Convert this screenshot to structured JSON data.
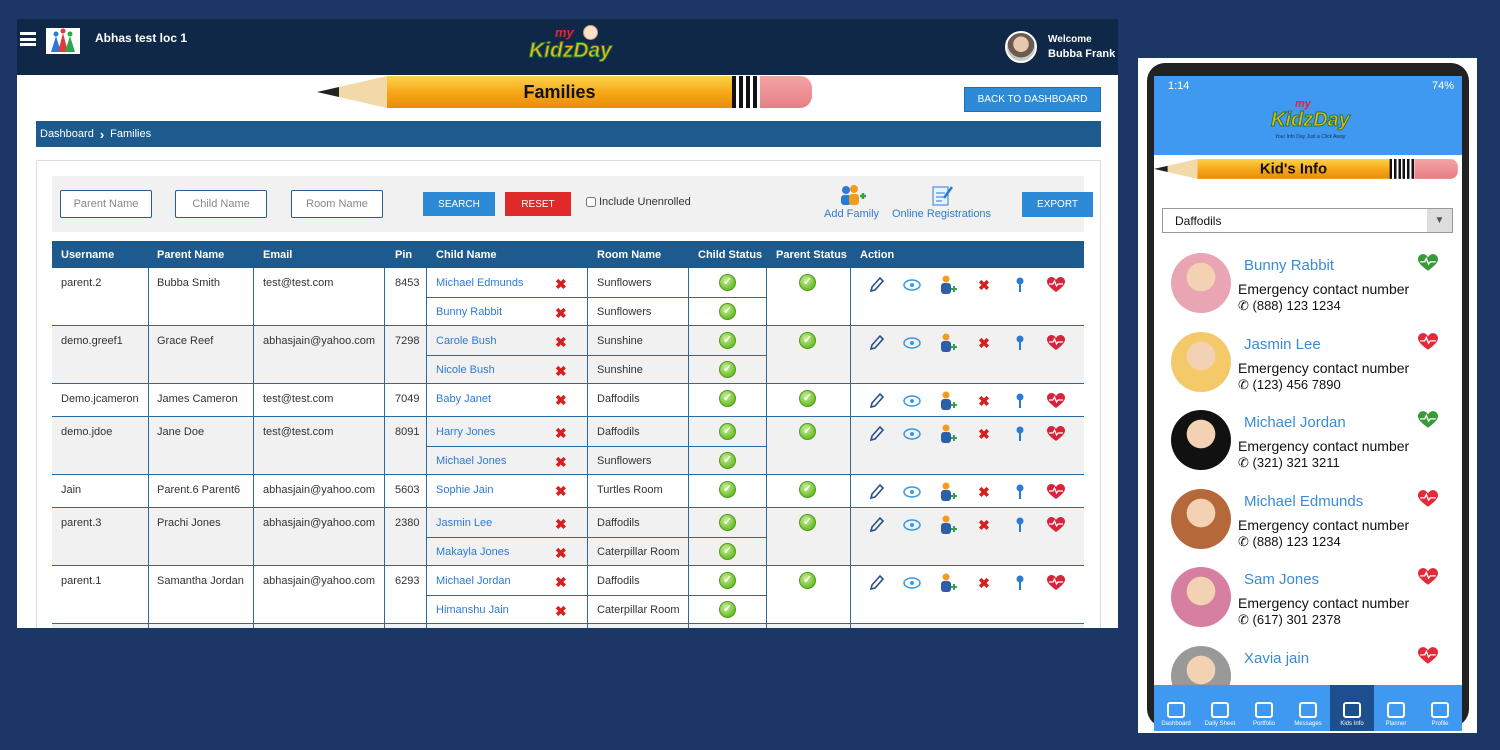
{
  "desktop": {
    "location_name": "Abhas test loc 1",
    "brand_my": "my",
    "brand_name": "KidzDay",
    "welcome": "Welcome",
    "user_name": "Bubba Frank",
    "page_banner": "Families",
    "back_button": "BACK TO DASHBOARD",
    "breadcrumb": [
      "Dashboard",
      "Families"
    ],
    "filters": {
      "parent_placeholder": "Parent Name",
      "child_placeholder": "Child Name",
      "room_placeholder": "Room Name",
      "search_label": "SEARCH",
      "reset_label": "RESET",
      "unenrolled_label": "Include Unenrolled",
      "add_family_label": "Add Family",
      "online_reg_label": "Online Registrations",
      "export_label": "EXPORT"
    },
    "columns": [
      "Username",
      "Parent Name",
      "Email",
      "Pin",
      "Child Name",
      "Room Name",
      "Child Status",
      "Parent Status",
      "Action"
    ],
    "families": [
      {
        "username": "parent.2",
        "parent": "Bubba Smith",
        "email": "test@test.com",
        "pin": "8453",
        "children": [
          {
            "name": "Michael Edmunds",
            "room": "Sunflowers"
          },
          {
            "name": "Bunny Rabbit",
            "room": "Sunflowers"
          }
        ]
      },
      {
        "username": "demo.greef1",
        "parent": "Grace Reef",
        "email": "abhasjain@yahoo.com",
        "pin": "7298",
        "children": [
          {
            "name": "Carole Bush",
            "room": "Sunshine"
          },
          {
            "name": "Nicole Bush",
            "room": "Sunshine"
          }
        ]
      },
      {
        "username": "Demo.jcameron",
        "parent": "James Cameron",
        "email": "test@test.com",
        "pin": "7049",
        "children": [
          {
            "name": "Baby Janet",
            "room": "Daffodils"
          }
        ]
      },
      {
        "username": "demo.jdoe",
        "parent": "Jane Doe",
        "email": "test@test.com",
        "pin": "8091",
        "children": [
          {
            "name": "Harry Jones",
            "room": "Daffodils"
          },
          {
            "name": "Michael Jones",
            "room": "Sunflowers"
          }
        ]
      },
      {
        "username": "Jain",
        "parent": "Parent.6 Parent6",
        "email": "abhasjain@yahoo.com",
        "pin": "5603",
        "children": [
          {
            "name": "Sophie Jain",
            "room": "Turtles Room"
          }
        ]
      },
      {
        "username": "parent.3",
        "parent": "Prachi Jones",
        "email": "abhasjain@yahoo.com",
        "pin": "2380",
        "children": [
          {
            "name": "Jasmin Lee",
            "room": "Daffodils"
          },
          {
            "name": "Makayla Jones",
            "room": "Caterpillar Room"
          }
        ]
      },
      {
        "username": "parent.1",
        "parent": "Samantha Jordan",
        "email": "abhasjain@yahoo.com",
        "pin": "6293",
        "children": [
          {
            "name": "Michael Jordan",
            "room": "Daffodils"
          },
          {
            "name": "Himanshu Jain",
            "room": "Caterpillar Room"
          }
        ]
      }
    ]
  },
  "phone": {
    "time": "1:14",
    "battery": "74%",
    "brand_my": "my",
    "brand_name": "KidzDay",
    "tagline": "Your Info Day Just a Click Away",
    "banner": "Kid's Info",
    "room": "Daffodils",
    "emergency_label": "Emergency contact number",
    "kids": [
      {
        "name": "Bunny Rabbit",
        "phone": "(888) 123 1234",
        "heart": "#3a9a3a",
        "pic": "#e9a5b3"
      },
      {
        "name": "Jasmin Lee",
        "phone": "(123) 456 7890",
        "heart": "#e22a3a",
        "pic": "#f4c96a"
      },
      {
        "name": "Michael Jordan",
        "phone": "(321) 321 3211",
        "heart": "#3a9a3a",
        "pic": "#111111"
      },
      {
        "name": "Michael Edmunds",
        "phone": "(888) 123 1234",
        "heart": "#e22a3a",
        "pic": "#b5693b"
      },
      {
        "name": "Sam Jones",
        "phone": "(617) 301 2378",
        "heart": "#e22a3a",
        "pic": "#d77fa0"
      },
      {
        "name": "Xavia jain",
        "phone": "",
        "heart": "#e22a3a",
        "pic": "#999999"
      }
    ],
    "nav": [
      "Dashboard",
      "Daily Sheet",
      "Portfolio",
      "Messages",
      "Kids Info",
      "Planner",
      "Profile"
    ],
    "nav_active": "Kids Info"
  },
  "colors": {
    "accent": "#2d8ad6",
    "navy": "#1d5b8e",
    "danger": "#e02929",
    "phone_blue": "#3f99f0"
  }
}
